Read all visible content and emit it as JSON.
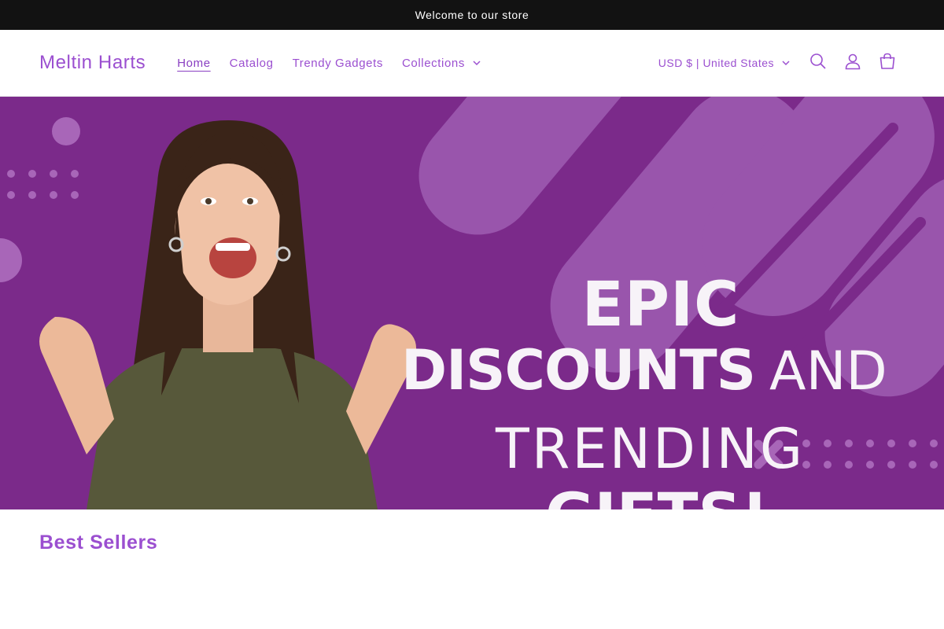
{
  "announcement": {
    "text": "Welcome to our store"
  },
  "header": {
    "logo": "Meltin Harts",
    "nav": [
      {
        "label": "Home",
        "active": true
      },
      {
        "label": "Catalog"
      },
      {
        "label": "Trendy Gadgets"
      },
      {
        "label": "Collections",
        "has_dropdown": true
      }
    ],
    "locale": "USD $ | United States",
    "icons": [
      "search-icon",
      "account-icon",
      "cart-icon"
    ]
  },
  "hero": {
    "line1": "EPIC",
    "line2_bold": "DISCOUNTS",
    "line2_thin": "AND",
    "line3": "TRENDING",
    "line4": "GIFTS!"
  },
  "sections": {
    "best_sellers_title": "Best Sellers"
  },
  "colors": {
    "accent": "#9b4fd0",
    "hero_bg": "#7b2a8a",
    "announcement_bg": "#121212"
  }
}
